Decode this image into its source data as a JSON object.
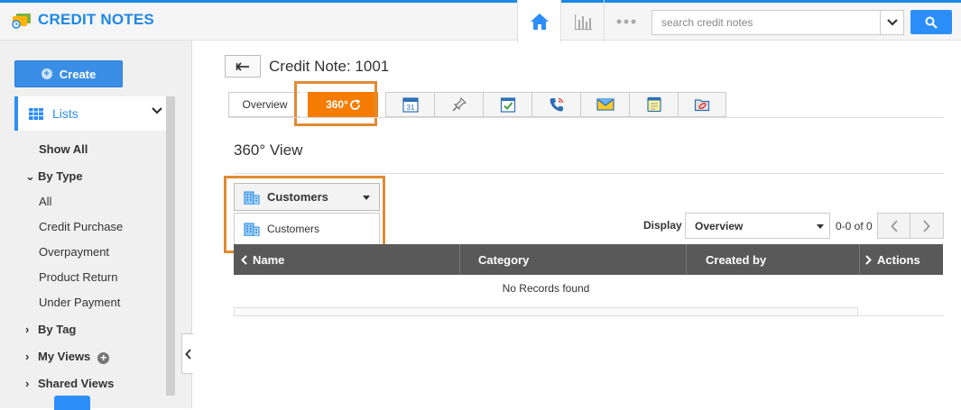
{
  "app": {
    "title": "CREDIT NOTES"
  },
  "topnav": {
    "items": [
      "home-icon",
      "chart-icon",
      "more-icon"
    ]
  },
  "search": {
    "placeholder": "search credit notes"
  },
  "sidebar": {
    "create_label": "Create",
    "lists_label": "Lists",
    "show_all": "Show All",
    "by_type": "By Type",
    "type_items": [
      "All",
      "Credit Purchase",
      "Overpayment",
      "Product Return",
      "Under Payment"
    ],
    "by_tag": "By Tag",
    "my_views": "My Views",
    "shared_views": "Shared Views"
  },
  "page": {
    "title": "Credit Note: 1001"
  },
  "tabs": [
    {
      "label": "Overview",
      "type": "text"
    },
    {
      "label": "360°",
      "type": "active",
      "icon": "refresh-icon"
    },
    {
      "label": "",
      "icon": "calendar-icon",
      "calendar_day": "31"
    },
    {
      "label": "",
      "icon": "pin-icon"
    },
    {
      "label": "",
      "icon": "task-icon"
    },
    {
      "label": "",
      "icon": "phone-icon"
    },
    {
      "label": "",
      "icon": "mail-icon"
    },
    {
      "label": "",
      "icon": "note-icon"
    },
    {
      "label": "",
      "icon": "attachment-icon"
    }
  ],
  "view": {
    "title": "360° View",
    "selected": "Customers",
    "options": [
      "Customers"
    ]
  },
  "display": {
    "label": "Display",
    "selected": "Overview",
    "pager_text": "0-0 of 0"
  },
  "grid": {
    "columns": [
      "Name",
      "Category",
      "Created by",
      "Actions"
    ],
    "empty_text": "No Records found"
  },
  "colors": {
    "accent": "#2c8ef8",
    "active_tab": "#f57c00",
    "highlight": "#e08a33",
    "grid_header": "#595959"
  }
}
